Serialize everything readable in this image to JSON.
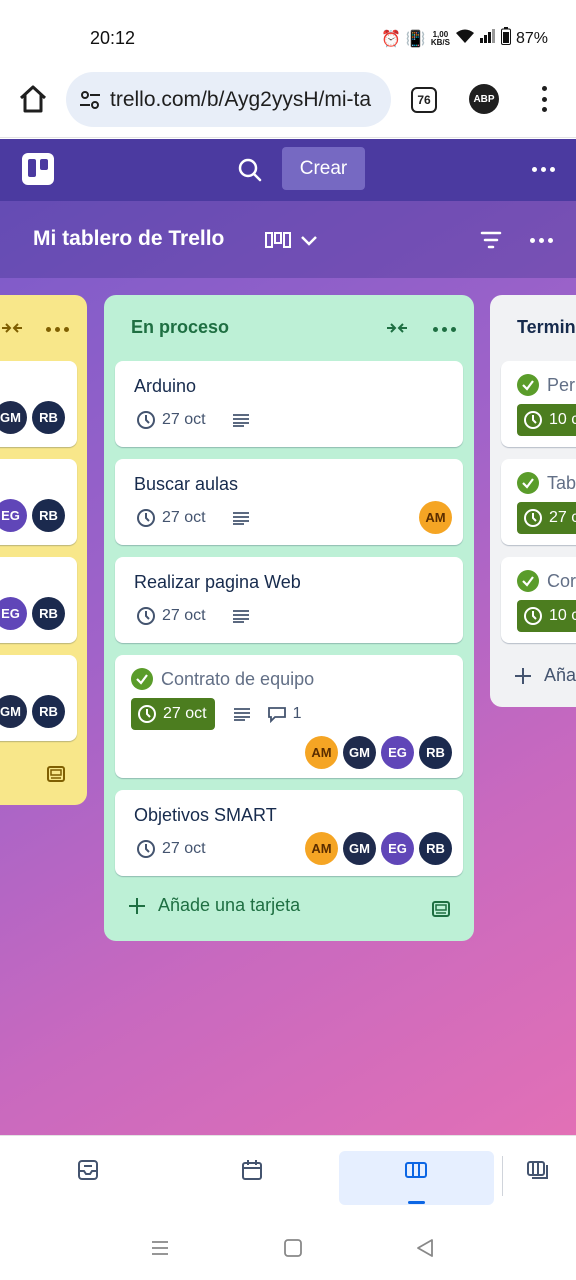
{
  "status": {
    "time": "20:12",
    "net_speed_top": "1,00",
    "net_speed_bottom": "KB/S",
    "battery": "87%"
  },
  "browser": {
    "url": "trello.com/b/Ayg2yysH/mi-ta",
    "tab_count": "76",
    "adblock_label": "ABP"
  },
  "header": {
    "create_label": "Crear"
  },
  "board": {
    "title": "Mi tablero de Trello"
  },
  "lists": [
    {
      "id": "left",
      "cards": [
        {
          "avatars": [
            "GM",
            "RB"
          ]
        },
        {
          "avatars": [
            "EG",
            "RB"
          ]
        },
        {
          "avatars": [
            "EG",
            "RB"
          ]
        },
        {
          "avatars": [
            "GM",
            "RB"
          ]
        }
      ]
    },
    {
      "id": "mid",
      "title": "En proceso",
      "cards": [
        {
          "title": "Arduino",
          "due": "27 oct",
          "avatars": []
        },
        {
          "title": "Buscar aulas",
          "due": "27 oct",
          "avatars": [
            "AM"
          ]
        },
        {
          "title": "Realizar pagina Web",
          "due": "27 oct",
          "avatars": []
        },
        {
          "title": "Contrato de equipo",
          "due": "27 oct",
          "comments": "1",
          "completed": true,
          "avatars": [
            "AM",
            "GM",
            "EG",
            "RB"
          ]
        },
        {
          "title": "Objetivos SMART",
          "due": "27 oct",
          "avatars": [
            "AM",
            "GM",
            "EG",
            "RB"
          ]
        }
      ],
      "add_card_label": "Añade una tarjeta"
    },
    {
      "id": "right",
      "title": "Termin",
      "cards": [
        {
          "title": "Per",
          "due": "10 c"
        },
        {
          "title": "Tab",
          "due": "27 c"
        },
        {
          "title": "Cor",
          "due": "10 c"
        }
      ],
      "add_card_label": "Aña"
    }
  ],
  "colors": {
    "header": "#4b3aa0",
    "list_mid": "#bdf0d6",
    "list_left": "#f8e78a",
    "done_green": "#4c7d1f",
    "accent": "#0c66e4"
  },
  "icons": [
    "home-icon",
    "tune-icon",
    "search-icon",
    "board-view-icon",
    "chevron-down-icon",
    "filter-icon",
    "clock-icon",
    "description-icon",
    "comment-icon",
    "check-icon",
    "plus-icon",
    "template-icon",
    "inbox-icon",
    "calendar-icon",
    "board-icon",
    "switch-boards-icon"
  ]
}
